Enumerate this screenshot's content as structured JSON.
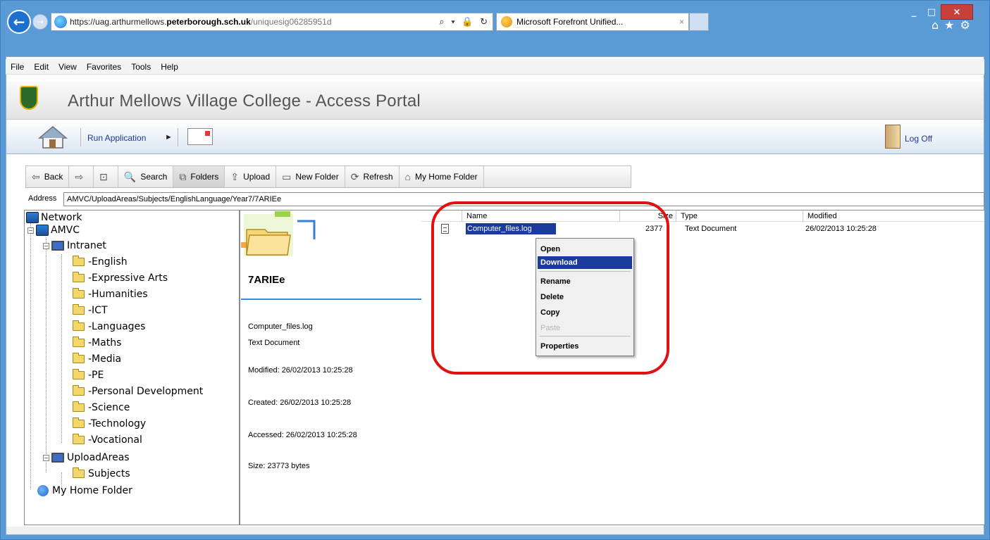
{
  "browser": {
    "url_prefix": "https://uag.arthurmellows.",
    "url_domain": "peterborough.sch.uk",
    "url_rest": "/uniquesig06285951d",
    "url_tools": "⌕ ▾ 🔒 ↻",
    "tab_title": "Microsoft Forefront Unified...",
    "tab_close": "×",
    "win_min": "_",
    "win_max": "□",
    "win_close": "×",
    "right_icons": "⌂★⚙"
  },
  "menubar": [
    "File",
    "Edit",
    "View",
    "Favorites",
    "Tools",
    "Help"
  ],
  "portal": {
    "title": "Arthur Mellows Village College - Access Portal",
    "run_application": "Run Application",
    "run_arrow": "►",
    "log_off": "Log Off"
  },
  "toolbar": {
    "back": "Back",
    "back_icon": "⇦",
    "forward_icon": "⇨",
    "up_icon": "⊡",
    "search": "Search",
    "search_icon": "🔍",
    "folders": "Folders",
    "folders_icon": "⧉",
    "upload": "Upload",
    "upload_icon": "⇪",
    "new_folder": "New Folder",
    "new_folder_icon": "▭",
    "refresh": "Refresh",
    "refresh_icon": "⟳",
    "my_home_folder": "My Home Folder",
    "my_home_icon": "⌂"
  },
  "address": {
    "label": "Address",
    "value": "AMVC/UploadAreas/Subjects/EnglishLanguage/Year7/7ARIEe"
  },
  "tree": {
    "network": "Network",
    "amvc": "AMVC",
    "intranet": "Intranet",
    "folders": [
      "-English",
      "-Expressive Arts",
      "-Humanities",
      "-ICT",
      "-Languages",
      "-Maths",
      "-Media",
      "-PE",
      "-Personal Development",
      "-Science",
      "-Technology",
      "-Vocational"
    ],
    "upload_areas": "UploadAreas",
    "subjects": "Subjects",
    "my_home_folder": "My Home Folder",
    "collapse_symbol": "−"
  },
  "info": {
    "folder_name": "7ARIEe",
    "file_name": "Computer_files.log",
    "file_type": "Text Document",
    "modified": "Modified: 26/02/2013 10:25:28",
    "created": "Created: 26/02/2013 10:25:28",
    "accessed": "Accessed: 26/02/2013 10:25:28",
    "size": "Size: 23773 bytes"
  },
  "list": {
    "headers": {
      "name": "Name",
      "size": "Size",
      "type": "Type",
      "modified": "Modified"
    },
    "rows": [
      {
        "name": "Computer_files.log",
        "size": "2377",
        "type": "Text Document",
        "modified": "26/02/2013 10:25:28"
      }
    ]
  },
  "context_menu": {
    "open": "Open",
    "download": "Download",
    "rename": "Rename",
    "delete": "Delete",
    "copy": "Copy",
    "paste": "Paste",
    "properties": "Properties"
  },
  "colors": {
    "frame": "#5b9bd5",
    "selection": "#1a3a9c",
    "highlight_ring": "#e01111",
    "portal_link": "#1c3b8a"
  }
}
